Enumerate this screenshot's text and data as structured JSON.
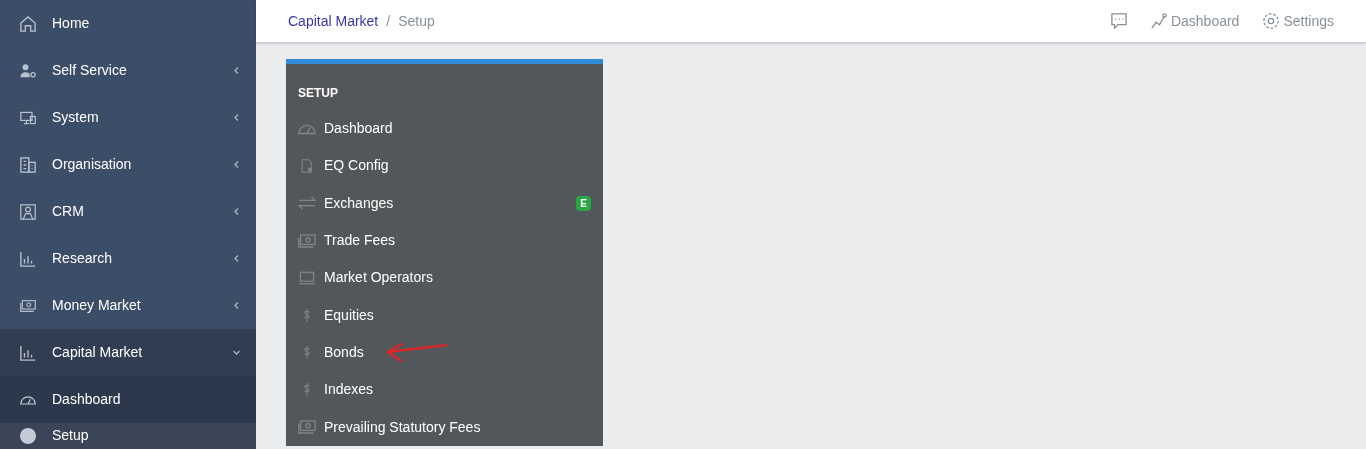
{
  "sidebar": {
    "items": [
      {
        "label": "Home",
        "expandable": false,
        "selected": false
      },
      {
        "label": "Self Service",
        "expandable": true,
        "expanded": false,
        "selected": false
      },
      {
        "label": "System",
        "expandable": true,
        "expanded": false,
        "selected": false
      },
      {
        "label": "Organisation",
        "expandable": true,
        "expanded": false,
        "selected": false
      },
      {
        "label": "CRM",
        "expandable": true,
        "expanded": false,
        "selected": false
      },
      {
        "label": "Research",
        "expandable": true,
        "expanded": false,
        "selected": false
      },
      {
        "label": "Money Market",
        "expandable": true,
        "expanded": false,
        "selected": false
      },
      {
        "label": "Capital Market",
        "expandable": true,
        "expanded": true,
        "selected": true,
        "children": [
          {
            "label": "Dashboard",
            "selected": true
          },
          {
            "label": "Setup",
            "selected": false
          }
        ]
      }
    ]
  },
  "breadcrumb": {
    "separator": "/",
    "items": [
      "Capital Market",
      "Setup"
    ]
  },
  "header_actions": [
    {
      "kind": "icon"
    },
    {
      "kind": "link",
      "label": "Dashboard"
    },
    {
      "kind": "link",
      "label": "Settings"
    }
  ],
  "setup_menu": {
    "title": "SETUP",
    "items": [
      {
        "label": "Dashboard"
      },
      {
        "label": "EQ Config"
      },
      {
        "label": "Exchanges",
        "badge": "E"
      },
      {
        "label": "Trade Fees"
      },
      {
        "label": "Market Operators"
      },
      {
        "label": "Equities"
      },
      {
        "label": "Bonds",
        "annotated": true
      },
      {
        "label": "Indexes"
      },
      {
        "label": "Prevailing Statutory Fees"
      }
    ]
  }
}
